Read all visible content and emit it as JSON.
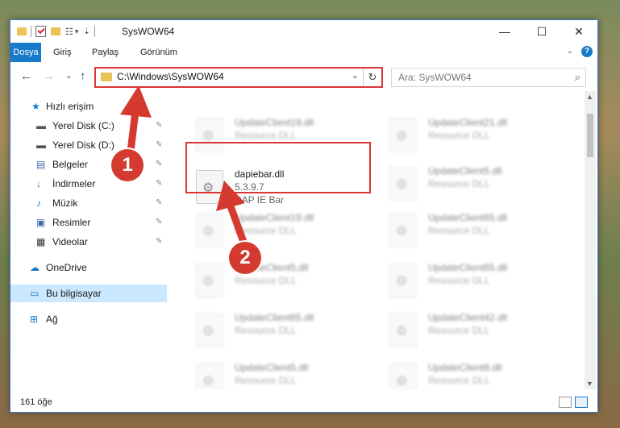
{
  "window": {
    "title": "SysWOW64",
    "controls": {
      "minimize": "—",
      "maximize": "☐",
      "close": "✕"
    }
  },
  "ribbon": {
    "tabs": [
      "Dosya",
      "Giriş",
      "Paylaş",
      "Görünüm"
    ],
    "help": "?"
  },
  "address": {
    "path": "C:\\Windows\\SysWOW64",
    "refresh": "↻",
    "dropdown": "⌄"
  },
  "search": {
    "placeholder": "Ara: SysWOW64",
    "icon": "🔍"
  },
  "nav": {
    "back": "←",
    "forward": "→",
    "recent": "⌄",
    "up": "↑",
    "items": [
      {
        "label": "Hızlı erişim",
        "icon": "star-icon",
        "pinned": false
      },
      {
        "label": "Yerel Disk (C:)",
        "icon": "drive-icon",
        "pinned": true
      },
      {
        "label": "Yerel Disk (D:)",
        "icon": "drive-icon",
        "pinned": true
      },
      {
        "label": "Belgeler",
        "icon": "documents-icon",
        "pinned": true
      },
      {
        "label": "İndirmeler",
        "icon": "download-icon",
        "pinned": true
      },
      {
        "label": "Müzik",
        "icon": "music-icon",
        "pinned": true
      },
      {
        "label": "Resimler",
        "icon": "pictures-icon",
        "pinned": true
      },
      {
        "label": "Videolar",
        "icon": "videos-icon",
        "pinned": true
      },
      {
        "label": "OneDrive",
        "icon": "cloud-icon",
        "pinned": false
      },
      {
        "label": "Bu bilgisayar",
        "icon": "computer-icon",
        "pinned": false,
        "selected": true
      },
      {
        "label": "Ağ",
        "icon": "network-icon",
        "pinned": false
      }
    ],
    "pin_glyph": "📌"
  },
  "files": {
    "left": [
      {
        "name": "UpdateClient19.dll",
        "desc": "Resource DLL"
      },
      {
        "name": "dapiebar.dll",
        "version": "5.3.9.7",
        "desc": "DAP IE Bar",
        "highlighted": true
      },
      {
        "name": "UpdateClient19.dll",
        "desc": "Resource DLL"
      },
      {
        "name": "UpdateClient5.dll",
        "desc": "Resource DLL"
      },
      {
        "name": "UpdateClient65.dll",
        "desc": "Resource DLL"
      },
      {
        "name": "UpdateClient5.dll",
        "desc": "Resource DLL"
      }
    ],
    "right": [
      {
        "name": "UpdateClient21.dll",
        "desc": "Resource DLL"
      },
      {
        "name": "UpdateClient5.dll",
        "desc": "Resource DLL"
      },
      {
        "name": "UpdateClient65.dll",
        "desc": "Resource DLL"
      },
      {
        "name": "UpdateClient65.dll",
        "desc": "Resource DLL"
      },
      {
        "name": "UpdateClient42.dll",
        "desc": "Resource DLL"
      },
      {
        "name": "UpdateClient8.dll",
        "desc": "Resource DLL"
      }
    ]
  },
  "status": {
    "count": "161 öğe"
  },
  "annotations": [
    "1",
    "2"
  ],
  "colors": {
    "accent": "#1979ca",
    "annotation": "#d43a2f",
    "selection": "#cce8ff"
  }
}
